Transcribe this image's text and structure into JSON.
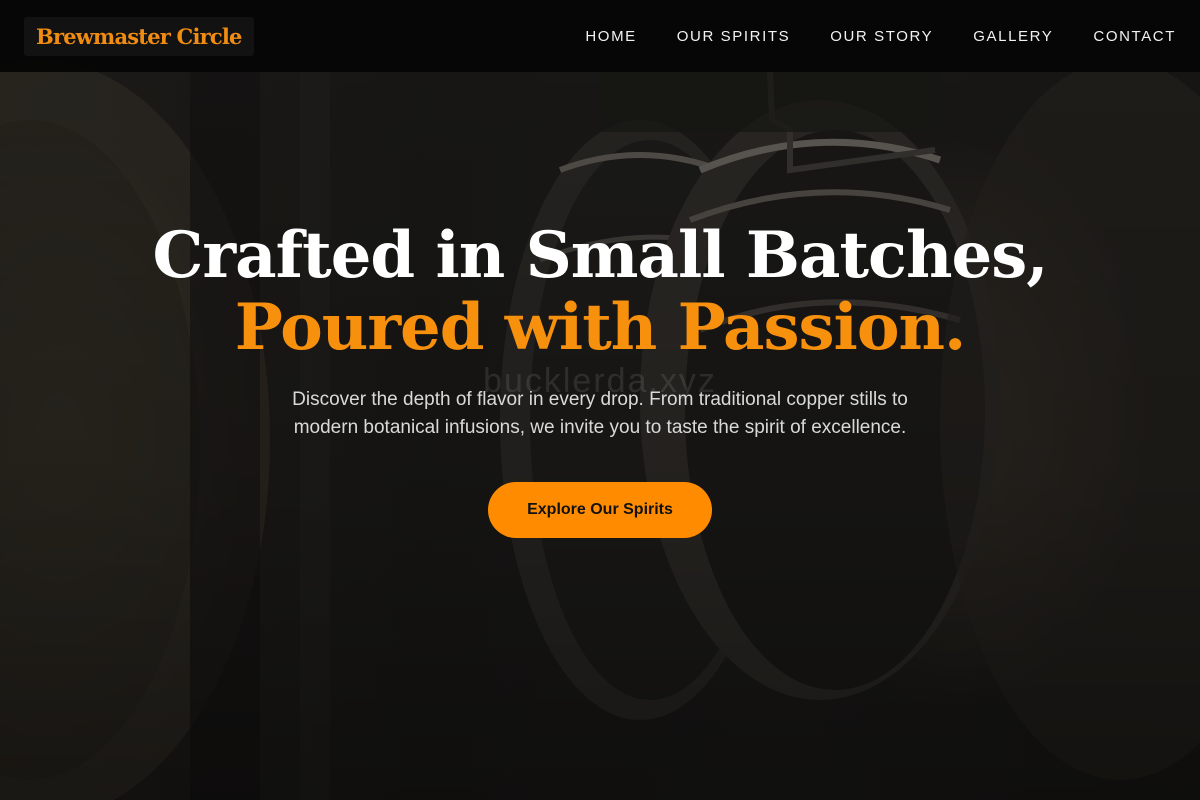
{
  "brand": {
    "name": "Brewmaster Circle",
    "color": "#f08c12"
  },
  "nav": {
    "items": [
      {
        "label": "HOME"
      },
      {
        "label": "OUR SPIRITS"
      },
      {
        "label": "OUR STORY"
      },
      {
        "label": "GALLERY"
      },
      {
        "label": "CONTACT"
      }
    ]
  },
  "hero": {
    "headline_line1": "Crafted in Small Batches,",
    "headline_line2": "Poured with Passion.",
    "description": "Discover the depth of flavor in every drop. From traditional copper stills to modern botanical infusions, we invite you to taste the spirit of excellence.",
    "cta_label": "Explore Our Spirits",
    "watermark": "bucklerda.xyz",
    "accent_color": "#f7900d",
    "background_image": "dim cellar of stacked oak barrels"
  }
}
